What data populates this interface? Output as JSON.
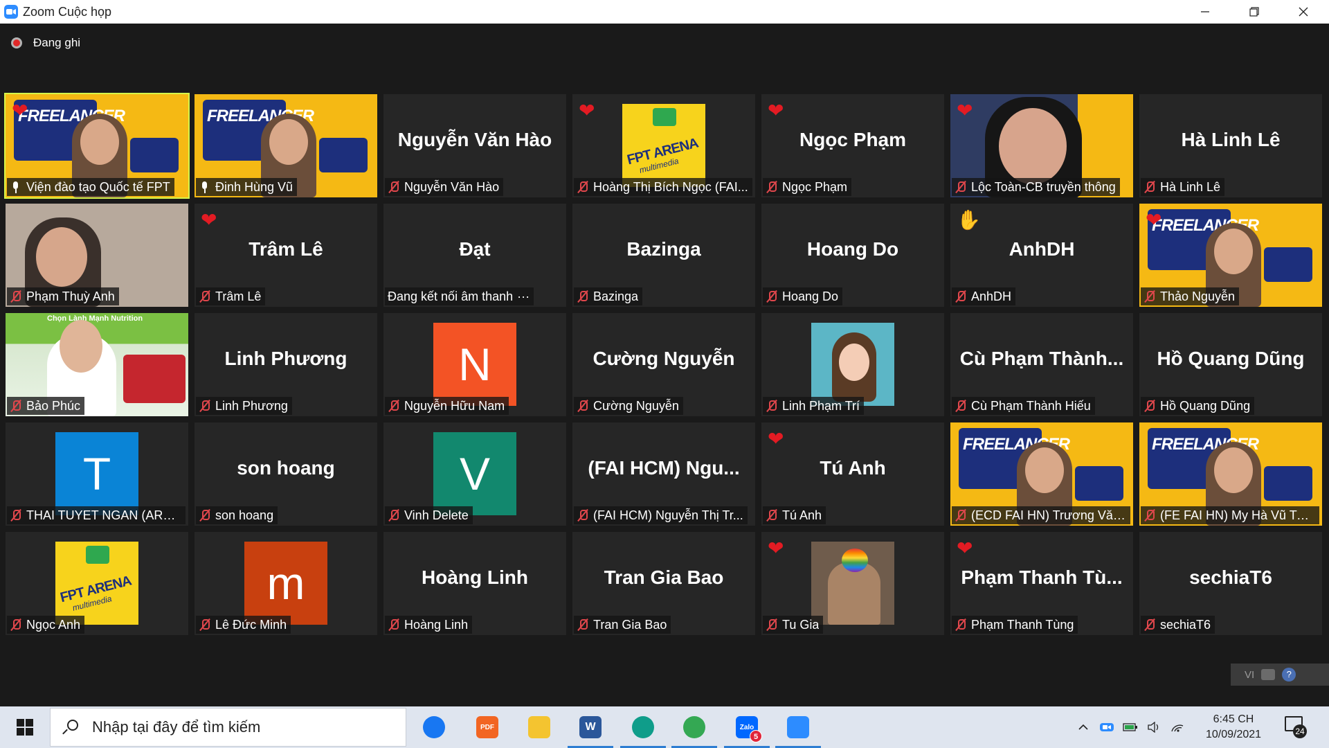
{
  "window": {
    "title": "Zoom Cuộc họp"
  },
  "recording": {
    "label": "Đang ghi"
  },
  "participants": [
    {
      "big": "",
      "tag": "Viện đào tạo Quốc tế FPT",
      "mic": "on",
      "reaction": "heart",
      "video": "freelancer-girl",
      "active": true
    },
    {
      "big": "",
      "tag": "Đinh Hùng Vũ",
      "mic": "on",
      "reaction": "",
      "video": "freelancer-man"
    },
    {
      "big": "Nguyễn Văn Hào",
      "tag": "Nguyễn Văn Hào",
      "mic": "off",
      "reaction": ""
    },
    {
      "big": "",
      "tag": "Hoàng Thị Bích Ngọc (FAI...",
      "mic": "off",
      "reaction": "heart",
      "thumb": "arena"
    },
    {
      "big": "Ngọc Phạm",
      "tag": "Ngọc Phạm",
      "mic": "off",
      "reaction": "heart"
    },
    {
      "big": "",
      "tag": "Lộc Toàn-CB truyền thông",
      "mic": "off",
      "reaction": "heart",
      "video": "loc"
    },
    {
      "big": "Hà Linh Lê",
      "tag": "Hà Linh Lê",
      "mic": "off",
      "reaction": ""
    },
    {
      "big": "",
      "tag": "Phạm Thuỳ Anh",
      "mic": "off",
      "reaction": "",
      "video": "room"
    },
    {
      "big": "Trâm Lê",
      "tag": "Trâm Lê",
      "mic": "off",
      "reaction": "heart"
    },
    {
      "big": "Đạt",
      "tag": "Đang kết nối âm thanh",
      "mic": "none",
      "reaction": "",
      "connecting": "···"
    },
    {
      "big": "Bazinga",
      "tag": "Bazinga",
      "mic": "off",
      "reaction": ""
    },
    {
      "big": "Hoang Do",
      "tag": "Hoang Do",
      "mic": "off",
      "reaction": ""
    },
    {
      "big": "AnhDH",
      "tag": "AnhDH",
      "mic": "off",
      "reaction": "wave"
    },
    {
      "big": "",
      "tag": "Thảo Nguyễn",
      "mic": "off",
      "reaction": "heart",
      "video": "freelancer-girl2"
    },
    {
      "big": "",
      "tag": "Bảo Phúc",
      "mic": "off",
      "reaction": "",
      "video": "green",
      "caption": "Chọn Lành Mạnh Nutrition"
    },
    {
      "big": "Linh Phương",
      "tag": "Linh Phương",
      "mic": "off",
      "reaction": ""
    },
    {
      "big": "",
      "tag": "Nguyễn Hữu Nam",
      "mic": "off",
      "reaction": "",
      "letter": "N",
      "letterColor": "#f35325"
    },
    {
      "big": "Cường Nguyễn",
      "tag": "Cường Nguyễn",
      "mic": "off",
      "reaction": ""
    },
    {
      "big": "",
      "tag": "Linh Phạm Trí",
      "mic": "off",
      "reaction": "",
      "thumb": "girl"
    },
    {
      "big": "Cù Phạm Thành...",
      "tag": "Cù Phạm Thành Hiếu",
      "mic": "off",
      "reaction": ""
    },
    {
      "big": "Hồ Quang Dũng",
      "tag": "Hồ Quang Dũng",
      "mic": "off",
      "reaction": ""
    },
    {
      "big": "",
      "tag": "THAI TUYET NGAN (AREN...",
      "mic": "off",
      "reaction": "",
      "letter": "T",
      "letterColor": "#0a84d6"
    },
    {
      "big": "son hoang",
      "tag": "son hoang",
      "mic": "off",
      "reaction": ""
    },
    {
      "big": "",
      "tag": "Vinh Delete",
      "mic": "off",
      "reaction": "",
      "letter": "V",
      "letterColor": "#12886e"
    },
    {
      "big": "(FAI HCM) Ngu...",
      "tag": "(FAI HCM) Nguyễn Thị Tr...",
      "mic": "off",
      "reaction": ""
    },
    {
      "big": "Tú Anh",
      "tag": "Tú Anh",
      "mic": "off",
      "reaction": "heart"
    },
    {
      "big": "",
      "tag": "(ECD FAI HN) Trương Văn Hải",
      "mic": "off",
      "reaction": "",
      "video": "freelancer-man2"
    },
    {
      "big": "",
      "tag": "(FE FAI HN) My Hà Vũ Tuy...",
      "mic": "off",
      "reaction": "",
      "video": "freelancer-girl3"
    },
    {
      "big": "",
      "tag": "Ngọc Anh",
      "mic": "off",
      "reaction": "",
      "thumb": "arena"
    },
    {
      "big": "",
      "tag": "Lê Đức Minh",
      "mic": "off",
      "reaction": "",
      "letter": "m",
      "letterColor": "#c8400f"
    },
    {
      "big": "Hoàng Linh",
      "tag": "Hoàng Linh",
      "mic": "off",
      "reaction": ""
    },
    {
      "big": "Tran Gia Bao",
      "tag": "Tran Gia Bao",
      "mic": "off",
      "reaction": ""
    },
    {
      "big": "",
      "tag": "Tu Gia",
      "mic": "off",
      "reaction": "heart",
      "thumb": "dark"
    },
    {
      "big": "Phạm Thanh Tù...",
      "tag": "Phạm Thanh Tùng",
      "mic": "off",
      "reaction": "heart"
    },
    {
      "big": "sechiaT6",
      "tag": "sechiaT6",
      "mic": "off",
      "reaction": ""
    }
  ],
  "assets": {
    "freelancer_label": "FREELANCER",
    "arena_label": "FPT ARENA",
    "arena_sub": "multimedia"
  },
  "mini_bar": {
    "lang": "VI",
    "help": "?"
  },
  "taskbar": {
    "search_placeholder": "Nhập tại đây để tìm kiếm",
    "apps": [
      {
        "name": "messenger",
        "color": "#1877f2",
        "glyph": "",
        "running": false
      },
      {
        "name": "pdf",
        "color": "#f26522",
        "glyph": "PDF",
        "running": false
      },
      {
        "name": "file-explorer",
        "color": "#f4c430",
        "glyph": "",
        "running": false
      },
      {
        "name": "word",
        "color": "#2b579a",
        "glyph": "W",
        "running": true
      },
      {
        "name": "edge",
        "color": "#0f9d8a",
        "glyph": "",
        "running": true
      },
      {
        "name": "chrome",
        "color": "#34a853",
        "glyph": "",
        "running": true
      },
      {
        "name": "zalo",
        "color": "#0068ff",
        "glyph": "Zalo",
        "badge": "5",
        "running": true
      },
      {
        "name": "zoom",
        "color": "#2d8cff",
        "glyph": "",
        "running": true
      }
    ],
    "clock": {
      "time": "6:45 CH",
      "date": "10/09/2021"
    },
    "notifications": "24"
  }
}
